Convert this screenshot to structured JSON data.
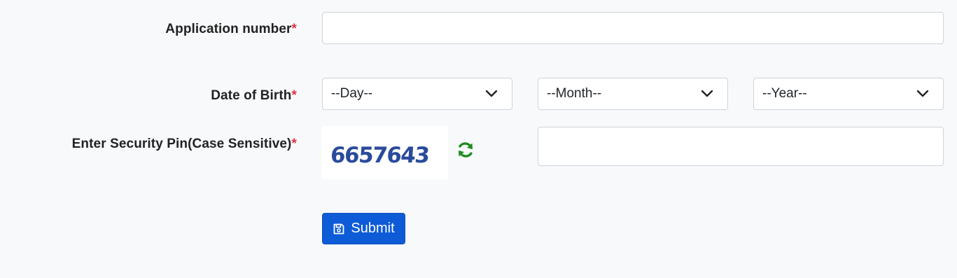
{
  "form": {
    "application_number": {
      "label": "Application number",
      "required_marker": "*",
      "value": ""
    },
    "date_of_birth": {
      "label": "Date of Birth",
      "required_marker": "*",
      "day": "--Day--",
      "month": "--Month--",
      "year": "--Year--"
    },
    "security_pin": {
      "label": "Enter Security Pin(Case Sensitive)",
      "required_marker": "*",
      "captcha_text": "6657643",
      "value": ""
    },
    "submit": {
      "label": "Submit",
      "icon": "save-icon"
    }
  },
  "colors": {
    "required": "#dc3545",
    "primary": "#0d5bd7",
    "captcha_text": "#2a4b9b",
    "refresh_icon": "#1e8c1e"
  }
}
